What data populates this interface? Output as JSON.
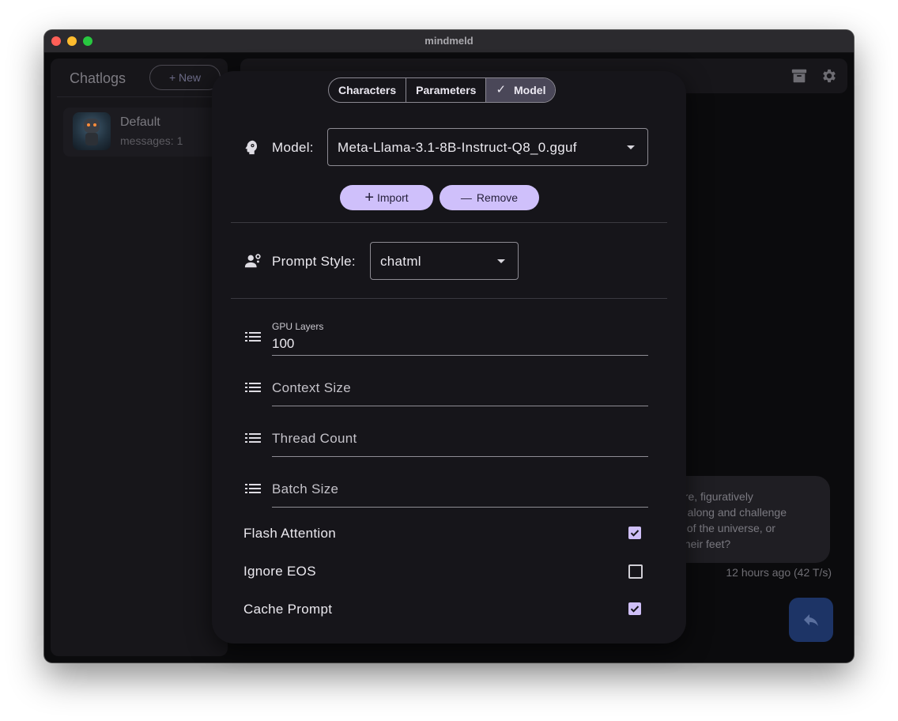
{
  "window": {
    "title": "mindmeld"
  },
  "sidebar": {
    "title": "Chatlogs",
    "new_button": "+ New",
    "chats": [
      {
        "name": "Default",
        "meta": "messages: 1"
      }
    ]
  },
  "background_chat": {
    "bubble_text": "ere, figuratively\ne along and challenge\ns of the universe, or\n their feet?",
    "timestamp": "12 hours ago (42 T/s)"
  },
  "icons": {
    "archive": "archive-icon",
    "settings": "gear-icon",
    "reply": "reply-icon",
    "model": "head-gear-icon",
    "prompt_style": "people-gear-icon",
    "list": "list-icon",
    "check": "check-icon"
  },
  "colors": {
    "accent": "#cfc0fb",
    "modal_bg": "#16151a",
    "fab": "#1d3466"
  },
  "modal": {
    "tabs": [
      {
        "label": "Characters",
        "active": false
      },
      {
        "label": "Parameters",
        "active": false
      },
      {
        "label": "Model",
        "active": true,
        "check": "✓"
      }
    ],
    "model": {
      "label": "Model:",
      "value": "Meta-Llama-3.1-8B-Instruct-Q8_0.gguf",
      "import_label": "Import",
      "remove_label": "Remove",
      "import_symbol": "+",
      "remove_symbol": "—"
    },
    "prompt_style": {
      "label": "Prompt Style:",
      "value": "chatml"
    },
    "fields": [
      {
        "label": "GPU Layers",
        "value": "100"
      },
      {
        "label": "Context Size",
        "value": ""
      },
      {
        "label": "Thread Count",
        "value": ""
      },
      {
        "label": "Batch Size",
        "value": ""
      }
    ],
    "checkboxes": [
      {
        "label": "Flash Attention",
        "checked": true
      },
      {
        "label": "Ignore EOS",
        "checked": false
      },
      {
        "label": "Cache Prompt",
        "checked": true
      }
    ]
  }
}
